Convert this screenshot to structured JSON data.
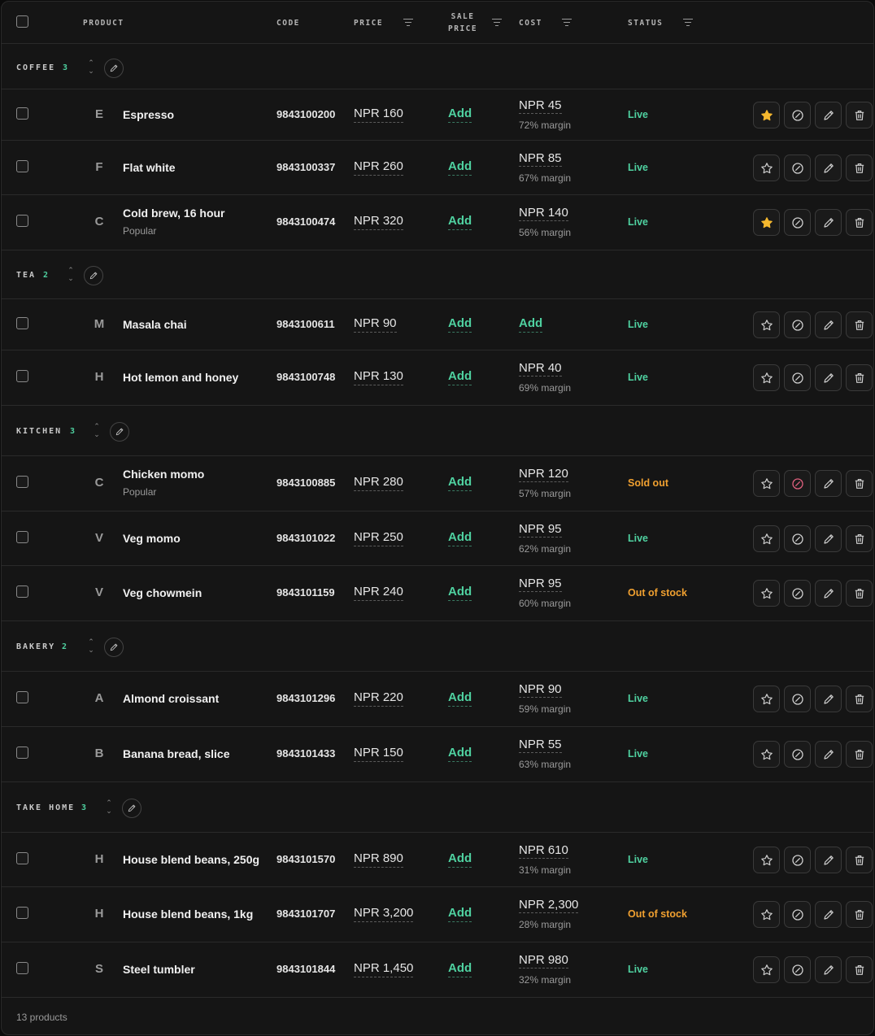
{
  "header": {
    "product": "PRODUCT",
    "code": "CODE",
    "price": "PRICE",
    "sale_price_l1": "SALE",
    "sale_price_l2": "PRICE",
    "cost": "COST",
    "status": "STATUS"
  },
  "groups": [
    {
      "name": "COFFEE",
      "count": "3"
    },
    {
      "name": "TEA",
      "count": "2"
    },
    {
      "name": "KITCHEN",
      "count": "3"
    },
    {
      "name": "BAKERY",
      "count": "2"
    },
    {
      "name": "TAKE HOME",
      "count": "3"
    }
  ],
  "rows": [
    {
      "initial": "E",
      "name": "Espresso",
      "sub": "",
      "code": "9843100200",
      "price": "NPR 160",
      "sale": "Add",
      "cost": "NPR 45",
      "margin": "72% margin",
      "status": "Live",
      "favorite": true
    },
    {
      "initial": "F",
      "name": "Flat white",
      "sub": "",
      "code": "9843100337",
      "price": "NPR 260",
      "sale": "Add",
      "cost": "NPR 85",
      "margin": "67% margin",
      "status": "Live",
      "favorite": false
    },
    {
      "initial": "C",
      "name": "Cold brew, 16 hour",
      "sub": "Popular",
      "code": "9843100474",
      "price": "NPR 320",
      "sale": "Add",
      "cost": "NPR 140",
      "margin": "56% margin",
      "status": "Live",
      "favorite": true
    },
    {
      "initial": "M",
      "name": "Masala chai",
      "sub": "",
      "code": "9843100611",
      "price": "NPR 90",
      "sale": "Add",
      "cost": "Add",
      "margin": "",
      "status": "Live",
      "favorite": false
    },
    {
      "initial": "H",
      "name": "Hot lemon and honey",
      "sub": "",
      "code": "9843100748",
      "price": "NPR 130",
      "sale": "Add",
      "cost": "NPR 40",
      "margin": "69% margin",
      "status": "Live",
      "favorite": false
    },
    {
      "initial": "C",
      "name": "Chicken momo",
      "sub": "Popular",
      "code": "9843100885",
      "price": "NPR 280",
      "sale": "Add",
      "cost": "NPR 120",
      "margin": "57% margin",
      "status": "Sold out",
      "favorite": false
    },
    {
      "initial": "V",
      "name": "Veg momo",
      "sub": "",
      "code": "9843101022",
      "price": "NPR 250",
      "sale": "Add",
      "cost": "NPR 95",
      "margin": "62% margin",
      "status": "Live",
      "favorite": false
    },
    {
      "initial": "V",
      "name": "Veg chowmein",
      "sub": "",
      "code": "9843101159",
      "price": "NPR 240",
      "sale": "Add",
      "cost": "NPR 95",
      "margin": "60% margin",
      "status": "Out of stock",
      "favorite": false
    },
    {
      "initial": "A",
      "name": "Almond croissant",
      "sub": "",
      "code": "9843101296",
      "price": "NPR 220",
      "sale": "Add",
      "cost": "NPR 90",
      "margin": "59% margin",
      "status": "Live",
      "favorite": false
    },
    {
      "initial": "B",
      "name": "Banana bread, slice",
      "sub": "",
      "code": "9843101433",
      "price": "NPR 150",
      "sale": "Add",
      "cost": "NPR 55",
      "margin": "63% margin",
      "status": "Live",
      "favorite": false
    },
    {
      "initial": "H",
      "name": "House blend beans, 250g",
      "sub": "",
      "code": "9843101570",
      "price": "NPR 890",
      "sale": "Add",
      "cost": "NPR 610",
      "margin": "31% margin",
      "status": "Live",
      "favorite": false
    },
    {
      "initial": "H",
      "name": "House blend beans, 1kg",
      "sub": "",
      "code": "9843101707",
      "price": "NPR 3,200",
      "sale": "Add",
      "cost": "NPR 2,300",
      "margin": "28% margin",
      "status": "Out of stock",
      "favorite": false
    },
    {
      "initial": "S",
      "name": "Steel tumbler",
      "sub": "",
      "code": "9843101844",
      "price": "NPR 1,450",
      "sale": "Add",
      "cost": "NPR 980",
      "margin": "32% margin",
      "status": "Live",
      "favorite": false
    }
  ],
  "colors": {
    "accent": "#4fd1a0",
    "warning": "#f0a030",
    "favorite": "#f5b82e",
    "danger": "#e0607e"
  },
  "footer": {
    "count": "13 products"
  }
}
